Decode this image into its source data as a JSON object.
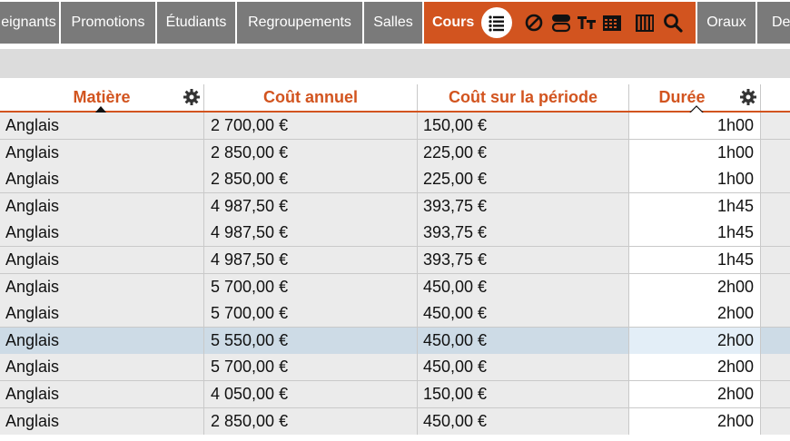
{
  "nav": {
    "tabs": [
      {
        "id": "enseignants",
        "label": "eignants"
      },
      {
        "id": "promotions",
        "label": "Promotions"
      },
      {
        "id": "etudiants",
        "label": "Étudiants"
      },
      {
        "id": "regroupements",
        "label": "Regroupements"
      },
      {
        "id": "salles",
        "label": "Salles"
      },
      {
        "id": "cours",
        "label": "Cours",
        "active": true
      },
      {
        "id": "oraux",
        "label": "Oraux"
      },
      {
        "id": "de",
        "label": "De"
      }
    ],
    "tools": [
      "list-icon",
      "cancel-icon",
      "stack-icon",
      "text-format-icon",
      "calendar-grid-icon",
      "columns-grid-icon",
      "search-icon"
    ]
  },
  "colors": {
    "accent": "#d2541f",
    "tab_gray": "#7a7a7a",
    "row_bg": "#ebebeb",
    "row_selected": "#cddbe6"
  },
  "table": {
    "columns": [
      {
        "id": "matiere",
        "label": "Matière",
        "sort": "ascending",
        "has_settings": true
      },
      {
        "id": "cout_annuel",
        "label": "Coût annuel"
      },
      {
        "id": "cout_periode",
        "label": "Coût sur la période"
      },
      {
        "id": "duree",
        "label": "Durée",
        "sort": "inactive",
        "has_settings": true
      }
    ],
    "rows": [
      {
        "matiere": "Anglais",
        "cout_annuel": "2 700,00 €",
        "cout_periode": "150,00 €",
        "duree": "1h00"
      },
      {
        "matiere": "Anglais",
        "cout_annuel": "2 850,00 €",
        "cout_periode": "225,00 €",
        "duree": "1h00"
      },
      {
        "matiere": "Anglais",
        "cout_annuel": "2 850,00 €",
        "cout_periode": "225,00 €",
        "duree": "1h00"
      },
      {
        "matiere": "Anglais",
        "cout_annuel": "4 987,50 €",
        "cout_periode": "393,75 €",
        "duree": "1h45"
      },
      {
        "matiere": "Anglais",
        "cout_annuel": "4 987,50 €",
        "cout_periode": "393,75 €",
        "duree": "1h45"
      },
      {
        "matiere": "Anglais",
        "cout_annuel": "4 987,50 €",
        "cout_periode": "393,75 €",
        "duree": "1h45"
      },
      {
        "matiere": "Anglais",
        "cout_annuel": "5 700,00 €",
        "cout_periode": "450,00 €",
        "duree": "2h00"
      },
      {
        "matiere": "Anglais",
        "cout_annuel": "5 700,00 €",
        "cout_periode": "450,00 €",
        "duree": "2h00"
      },
      {
        "matiere": "Anglais",
        "cout_annuel": "5 550,00 €",
        "cout_periode": "450,00 €",
        "duree": "2h00",
        "selected": true
      },
      {
        "matiere": "Anglais",
        "cout_annuel": "5 700,00 €",
        "cout_periode": "450,00 €",
        "duree": "2h00"
      },
      {
        "matiere": "Anglais",
        "cout_annuel": "4 050,00 €",
        "cout_periode": "150,00 €",
        "duree": "2h00"
      },
      {
        "matiere": "Anglais",
        "cout_annuel": "2 850,00 €",
        "cout_periode": "450,00 €",
        "duree": "2h00"
      }
    ]
  }
}
